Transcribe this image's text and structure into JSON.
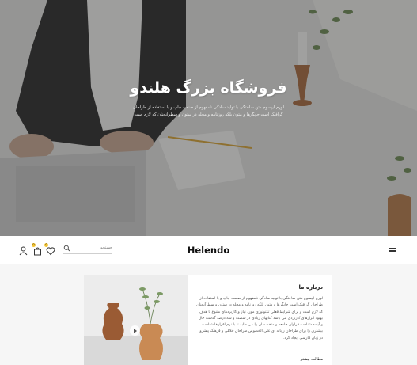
{
  "hero": {
    "title": "فروشگاه بزرگ هلندو",
    "description": "لورم ایپسوم متن ساختگی با تولید سادگی نامفهوم از صنعت چاپ و با استفاده از طراحان گرافیک است چاپگرها و متون بلکه روزنامه و مجله در ستون و سطرآنچنان که لازم است"
  },
  "header": {
    "logo": "Helendo",
    "search_placeholder": "جستجو",
    "cart_count": "0",
    "wishlist_count": "0"
  },
  "about": {
    "title": "درباره ما",
    "text": "لورم ایپسوم متن ساختگی با تولید سادگی نامفهوم از صنعت چاپ و با استفاده از طراحان گرافیک است چاپگرها و متون بلکه روزنامه و مجله در ستون و سطرآنچنان که لازم است و برای شرایط فعلی تکنولوژی مورد نیاز و کاربردهای متنوع با هدف بهبود ابزارهای کاربردی می باشد کتابهای زیادی در شصت و سه درصد گذشته حال و آینده شناخت فراوان جامعه و متخصصان را می طلبد تا با نرم افزارها شناخت بیشتری را برای طراحان رایانه ای علی الخصوص طراحان خلاقی و فرهنگ پیشرو در زبان فارسی ایجاد کرد.",
    "more_label": "مطالعه بیشتر +"
  },
  "icons": {
    "menu": "hamburger-icon",
    "user": "user-icon",
    "cart": "shopping-bag-icon",
    "wishlist": "heart-icon",
    "search": "search-icon",
    "play": "play-icon"
  },
  "colors": {
    "badge": "#f2c230",
    "hero_overlay": "#282828"
  }
}
